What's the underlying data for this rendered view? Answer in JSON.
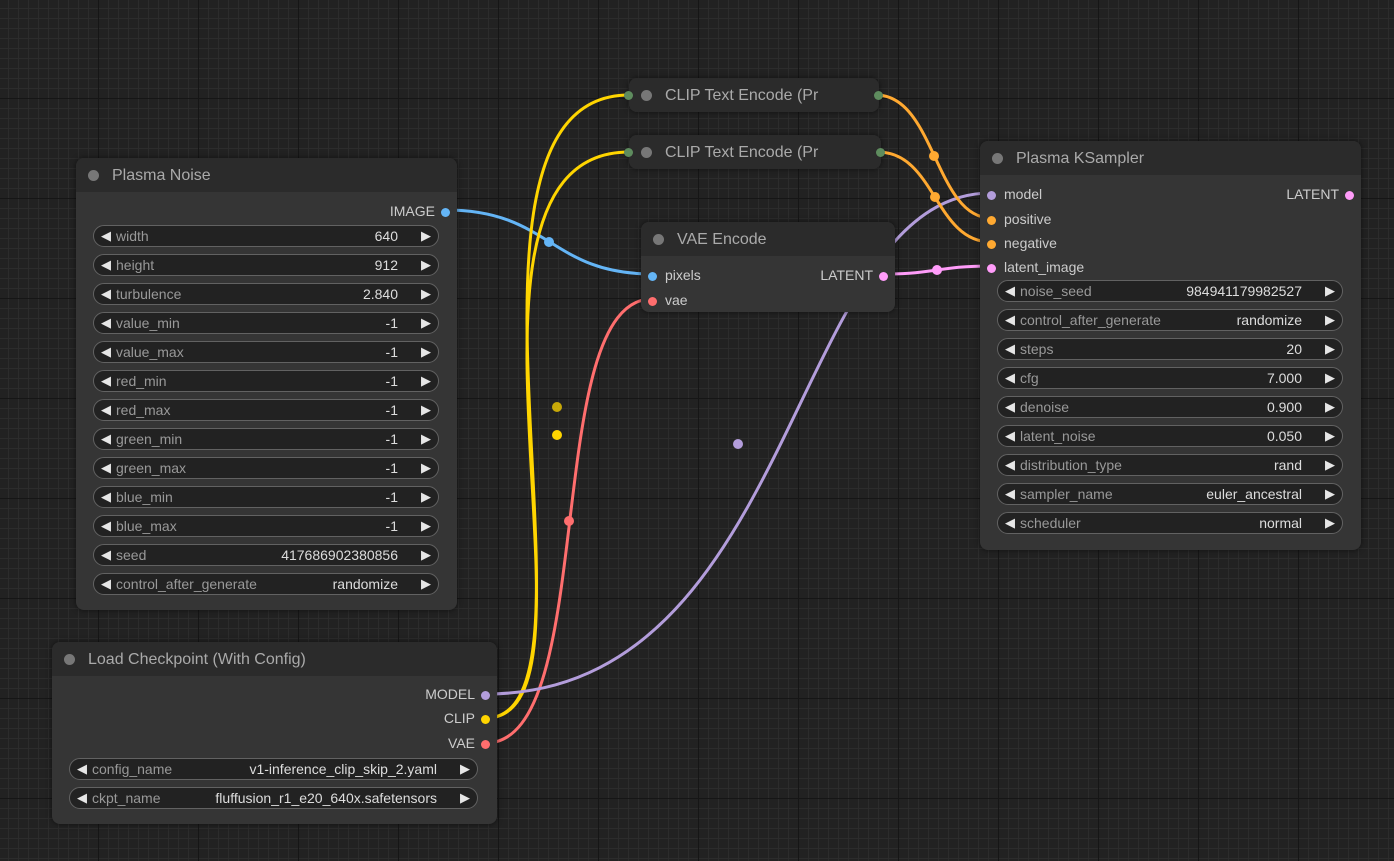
{
  "colors": {
    "image": "#64b5f6",
    "clip": "#ffd500",
    "vae": "#ff6e6e",
    "model": "#b39ddb",
    "latent": "#ff9cf9",
    "conditioning": "#ffa931",
    "collapsed_dot": "#5e8c5e"
  },
  "nodes": {
    "plasma_noise": {
      "title": "Plasma Noise",
      "output": "IMAGE",
      "widgets": [
        {
          "label": "width",
          "value": "640"
        },
        {
          "label": "height",
          "value": "912"
        },
        {
          "label": "turbulence",
          "value": "2.840"
        },
        {
          "label": "value_min",
          "value": "-1"
        },
        {
          "label": "value_max",
          "value": "-1"
        },
        {
          "label": "red_min",
          "value": "-1"
        },
        {
          "label": "red_max",
          "value": "-1"
        },
        {
          "label": "green_min",
          "value": "-1"
        },
        {
          "label": "green_max",
          "value": "-1"
        },
        {
          "label": "blue_min",
          "value": "-1"
        },
        {
          "label": "blue_max",
          "value": "-1"
        },
        {
          "label": "seed",
          "value": "417686902380856"
        },
        {
          "label": "control_after_generate",
          "value": "randomize"
        }
      ]
    },
    "load_checkpoint": {
      "title": "Load Checkpoint (With Config)",
      "outputs": [
        "MODEL",
        "CLIP",
        "VAE"
      ],
      "widgets": [
        {
          "label": "config_name",
          "value": "v1-inference_clip_skip_2.yaml"
        },
        {
          "label": "ckpt_name",
          "value": "fluffusion_r1_e20_640x.safetensors"
        }
      ]
    },
    "clip_text_encode_1": {
      "title": "CLIP Text Encode (Pr"
    },
    "clip_text_encode_2": {
      "title": "CLIP Text Encode (Pr"
    },
    "vae_encode": {
      "title": "VAE Encode",
      "inputs": [
        "pixels",
        "vae"
      ],
      "output": "LATENT"
    },
    "plasma_ksampler": {
      "title": "Plasma KSampler",
      "inputs": [
        "model",
        "positive",
        "negative",
        "latent_image"
      ],
      "output": "LATENT",
      "widgets": [
        {
          "label": "noise_seed",
          "value": "984941179982527"
        },
        {
          "label": "control_after_generate",
          "value": "randomize"
        },
        {
          "label": "steps",
          "value": "20"
        },
        {
          "label": "cfg",
          "value": "7.000"
        },
        {
          "label": "denoise",
          "value": "0.900"
        },
        {
          "label": "latent_noise",
          "value": "0.050"
        },
        {
          "label": "distribution_type",
          "value": "rand"
        },
        {
          "label": "sampler_name",
          "value": "euler_ancestral"
        },
        {
          "label": "scheduler",
          "value": "normal"
        }
      ]
    }
  }
}
